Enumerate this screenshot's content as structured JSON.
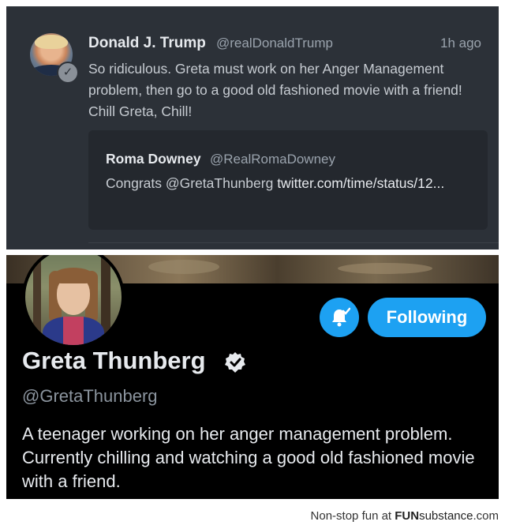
{
  "tweet": {
    "author_name": "Donald J. Trump",
    "author_handle": "@realDonaldTrump",
    "time": "1h ago",
    "text": "So ridiculous. Greta must work on her Anger Management problem, then go to a good old fashioned movie with a friend! Chill Greta, Chill!",
    "quote": {
      "author_name": "Roma Downey",
      "author_handle": "@RealRomaDowney",
      "text_prefix": "Congrats @GretaThunberg ",
      "link": "twitter.com/time/status/12..."
    }
  },
  "profile": {
    "name": "Greta Thunberg",
    "handle": "@GretaThunberg",
    "bio": "A teenager working on her anger management problem. Currently chilling and watching a good old fashioned movie with a friend.",
    "follow_label": "Following",
    "icons": {
      "verified": "verified-badge-icon",
      "notifications": "bell-check-icon"
    }
  },
  "colors": {
    "accent": "#1da1f2",
    "tweet_bg": "#2c3138",
    "profile_bg": "#000000"
  },
  "watermark": {
    "prefix": "Non-stop fun at ",
    "brand_fun": "FUN",
    "brand_substance": "substance",
    "brand_tld": ".com"
  }
}
